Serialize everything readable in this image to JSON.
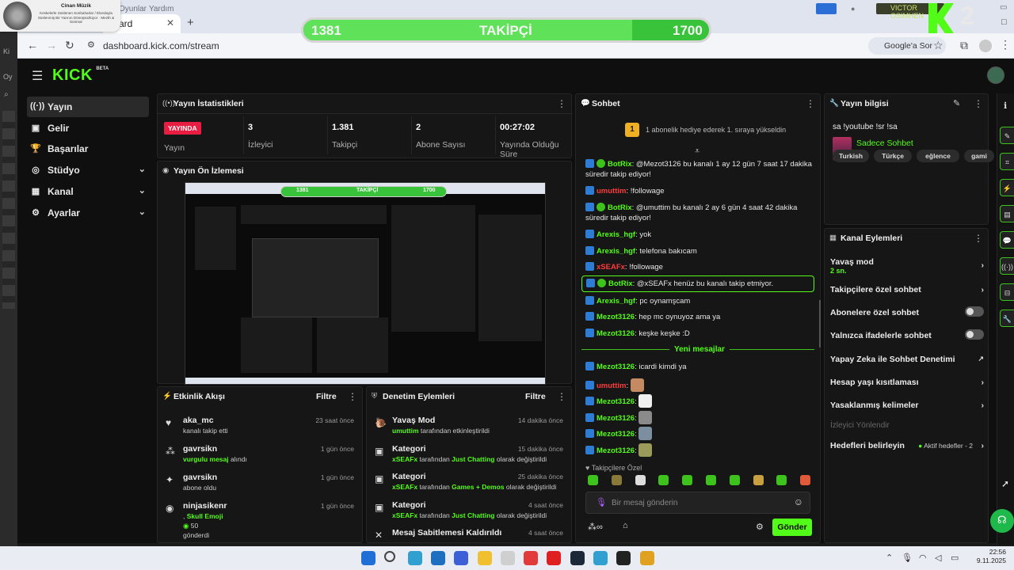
{
  "overlay": {
    "profile_name": "Cinan Müzik",
    "profile_desc": "Keskelerle Süslenen Sonbaharlar / Elvedayla Süslenmiş Bir Yarının Dönüşsüzlüyor · Mezth & Sonmar",
    "followers_current": "1381",
    "followers_label": "TAKİPÇİ",
    "followers_goal": "1700",
    "follow_progress": 0.81,
    "k2_number": "2",
    "victor_name": "VICTOR OSIMHEN",
    "menu_items": [
      "Oyunlar",
      "Yardım"
    ]
  },
  "browser": {
    "tab_title": "ard",
    "url": "dashboard.kick.com/stream",
    "google_ask": "Google'a Sor"
  },
  "kick": {
    "logo": "KICK",
    "logo_beta": "BETA",
    "sidebar": [
      {
        "label": "Yayın",
        "icon": "broadcast-icon",
        "chev": false,
        "active": true
      },
      {
        "label": "Gelir",
        "icon": "wallet-icon",
        "chev": false,
        "active": false
      },
      {
        "label": "Başarılar",
        "icon": "trophy-icon",
        "chev": false,
        "active": false
      },
      {
        "label": "Stüdyo",
        "icon": "studio-icon",
        "chev": true,
        "active": false
      },
      {
        "label": "Kanal",
        "icon": "channel-icon",
        "chev": true,
        "active": false
      },
      {
        "label": "Ayarlar",
        "icon": "settings-icon",
        "chev": true,
        "active": false
      }
    ],
    "stats": {
      "title": "Yayın İstatistikleri",
      "live_badge": "YAYINDA",
      "live_label": "Yayın",
      "items": [
        {
          "value": "3",
          "label": "İzleyici"
        },
        {
          "value": "1.381",
          "label": "Takipçi"
        },
        {
          "value": "2",
          "label": "Abone Sayısı"
        },
        {
          "value": "00:27:02",
          "label": "Yayında Olduğu Süre"
        }
      ]
    },
    "preview": {
      "title": "Yayın Ön İzlemesi",
      "mini_followers": "1381",
      "mini_label": "TAKİPÇİ",
      "mini_goal": "1700"
    },
    "events": {
      "title": "Etkinlik Akışı",
      "filter": "Filtre",
      "items": [
        {
          "name": "aka_mc",
          "time": "23 saat önce",
          "sub": "kanalı takip etti",
          "sub_green": "",
          "icon": "heart-icon"
        },
        {
          "name": "gavrsikn",
          "time": "1 gün önce",
          "sub_green": "vurgulu mesaj",
          "sub": "alındı",
          "icon": "sparkle-icon"
        },
        {
          "name": "gavrsikn",
          "time": "1 gün önce",
          "sub": "abone oldu",
          "sub_green": "",
          "icon": "star-icon"
        },
        {
          "name": "ninjasikenr",
          "time": "1 gün önce",
          "sub_green": "Skull Emoji",
          "sub": "",
          "icon": "kick-coin-icon",
          "extra_value": "50",
          "extra_text": "gönderdi"
        }
      ]
    },
    "moderation": {
      "title": "Denetim Eylemleri",
      "filter": "Filtre",
      "items": [
        {
          "title": "Yavaş Mod",
          "time": "14 dakika önce",
          "actor": "umuttim",
          "mid": "tarafından etkinleştirildi",
          "target": "",
          "tail": "",
          "icon": "snail-icon"
        },
        {
          "title": "Kategori",
          "time": "15 dakika önce",
          "actor": "xSEAFx",
          "mid": "tarafından",
          "target": "Just Chatting",
          "tail": "olarak değiştirildi",
          "icon": "category-icon"
        },
        {
          "title": "Kategori",
          "time": "25 dakika önce",
          "actor": "xSEAFx",
          "mid": "tarafından",
          "target": "Games + Demos",
          "tail": "olarak değiştirildi",
          "icon": "category-icon"
        },
        {
          "title": "Kategori",
          "time": "4 saat önce",
          "actor": "xSEAFx",
          "mid": "tarafından",
          "target": "Just Chatting",
          "tail": "olarak değiştirildi",
          "icon": "category-icon"
        },
        {
          "title": "Mesaj Sabitlemesi Kaldırıldı",
          "time": "4 saat önce",
          "actor": "",
          "mid": "",
          "target": "",
          "tail": "",
          "icon": "unpin-icon"
        }
      ]
    },
    "chat": {
      "title": "Sohbet",
      "gift_rank": "1",
      "gift_text": "1 abonelik hediye ederek 1. sıraya yükseldin",
      "messages": [
        {
          "user": "BotRix",
          "color": "#53fc18",
          "text": "@Mezot3126 bu kanalı 1 ay 12 gün 7 saat 17 dakika süredir takip ediyor!",
          "bot": true
        },
        {
          "user": "umuttim",
          "color": "#ff3b3b",
          "text": "!followage",
          "bot": false
        },
        {
          "user": "BotRix",
          "color": "#53fc18",
          "text": "@umuttim bu kanalı 2 ay 6 gün 4 saat 42 dakika süredir takip ediyor!",
          "bot": true
        },
        {
          "user": "Arexis_hgf",
          "color": "#53fc18",
          "text": "yok",
          "bot": false
        },
        {
          "user": "Arexis_hgf",
          "color": "#53fc18",
          "text": "telefona bakıcam",
          "bot": false
        },
        {
          "user": "xSEAFx",
          "color": "#ff3b3b",
          "text": "!followage",
          "bot": false
        },
        {
          "user": "BotRix",
          "color": "#53fc18",
          "text": "@xSEAFx henüz bu kanalı takip etmiyor.",
          "bot": true
        },
        {
          "user": "Arexis_hgf",
          "color": "#53fc18",
          "text": "pc oynamşcam",
          "bot": false
        },
        {
          "user": "Mezot3126",
          "color": "#53fc18",
          "text": "hep mc oynuyoz ama ya",
          "bot": false
        },
        {
          "user": "Mezot3126",
          "color": "#53fc18",
          "text": "keşke keşke :D",
          "bot": false
        }
      ],
      "new_messages": "Yeni mesajlar",
      "new_list": [
        {
          "user": "Mezot3126",
          "color": "#53fc18",
          "text": "icardi kimdi ya",
          "emote": false
        },
        {
          "user": "umuttim",
          "color": "#ff3b3b",
          "text": "",
          "emote": true
        },
        {
          "user": "Mezot3126",
          "color": "#53fc18",
          "text": "",
          "emote": true
        },
        {
          "user": "Mezot3126",
          "color": "#53fc18",
          "text": "",
          "emote": true
        },
        {
          "user": "Mezot3126",
          "color": "#53fc18",
          "text": "",
          "emote": true
        },
        {
          "user": "Mezot3126",
          "color": "#53fc18",
          "text": "",
          "emote": true
        }
      ],
      "followers_only": "Takipçilere Özel",
      "input_placeholder": "Bir mesaj gönderin",
      "send": "Gönder"
    },
    "stream_info": {
      "title": "Yayın bilgisi",
      "stream_title": "sa !youtube !sr !sa",
      "category": "Sadece Sohbet",
      "tags": [
        "Turkish",
        "Türkçe",
        "eğlence",
        "gami"
      ]
    },
    "channel_actions": {
      "title": "Kanal Eylemleri",
      "slow_mode": "Yavaş mod",
      "slow_value": "2 sn.",
      "followers_chat": "Takipçilere özel sohbet",
      "subs_chat": "Abonelere özel sohbet",
      "emotes_chat": "Yalnızca ifadelerle sohbet",
      "ai_mod": "Yapay Zeka ile Sohbet Denetimi",
      "age_restrict": "Hesap yaşı kısıtlaması",
      "banned_words": "Yasaklanmış kelimeler",
      "viewer_redirect": "İzleyici Yönlendir",
      "goals": "Hedefleri belirleyin",
      "goals_status": "Aktif hedefler - 2"
    }
  },
  "taskbar": {
    "time": "22:56",
    "date": "9.11.2025"
  },
  "colors": {
    "kick_green": "#53fc18",
    "live_red": "#e91d41",
    "panel_bg": "#161616"
  }
}
